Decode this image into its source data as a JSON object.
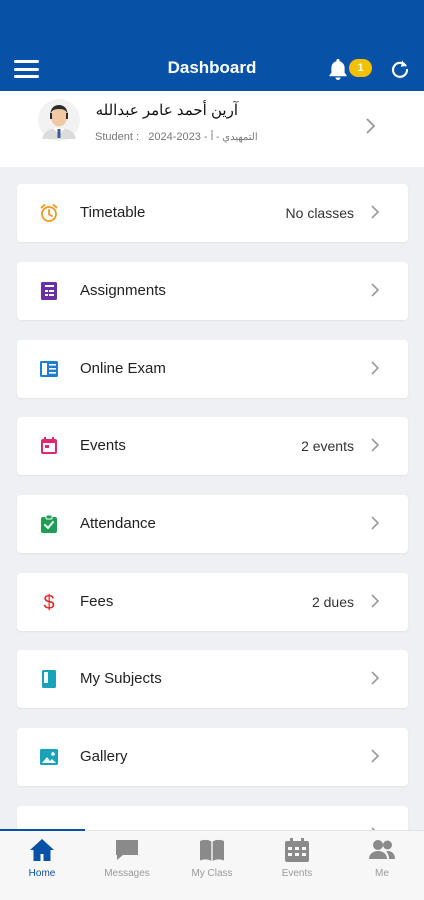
{
  "header": {
    "title": "Dashboard",
    "notifications_count": "1",
    "color": "#0752a6"
  },
  "profile": {
    "name": "آرين أحمد عامر عبدالله",
    "role": "Student :",
    "year": "2024-2023",
    "class": "التمهيدي - أ"
  },
  "cards": [
    {
      "label": "Timetable",
      "value": "No classes",
      "icon": "alarm-clock-icon"
    },
    {
      "label": "Assignments",
      "value": "",
      "icon": "assignment-book-icon"
    },
    {
      "label": "Online Exam",
      "value": "",
      "icon": "exam-sheet-icon"
    },
    {
      "label": "Events",
      "value": "2 events",
      "icon": "calendar-icon"
    },
    {
      "label": "Attendance",
      "value": "",
      "icon": "clipboard-check-icon"
    },
    {
      "label": "Fees",
      "value": "2 dues",
      "icon": "dollar-icon"
    },
    {
      "label": "My Subjects",
      "value": "",
      "icon": "book-icon"
    },
    {
      "label": "Gallery",
      "value": "",
      "icon": "image-icon"
    }
  ],
  "bottom_nav": [
    {
      "label": "Home",
      "icon": "home-icon",
      "active": true
    },
    {
      "label": "Messages",
      "icon": "chat-icon",
      "active": false
    },
    {
      "label": "My Class",
      "icon": "open-book-icon",
      "active": false
    },
    {
      "label": "Events",
      "icon": "calendar-icon",
      "active": false
    },
    {
      "label": "Me",
      "icon": "people-icon",
      "active": false
    }
  ]
}
